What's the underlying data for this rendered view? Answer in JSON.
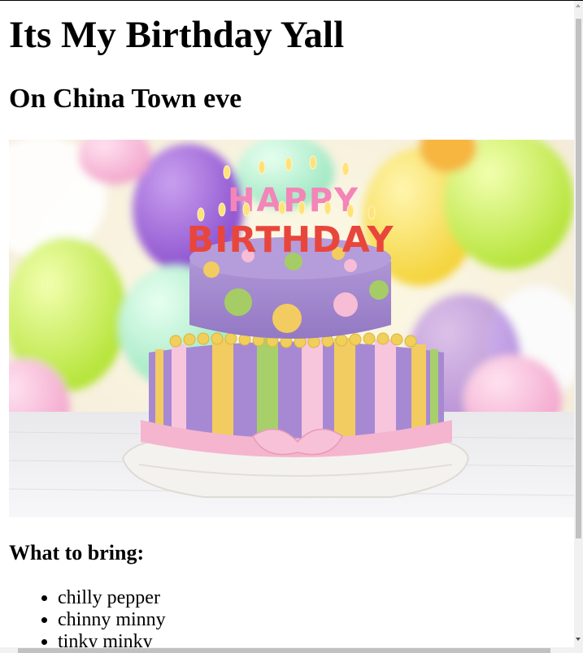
{
  "page": {
    "title": "Its My Birthday Yall",
    "subtitle": "On China Town eve",
    "list_heading": "What to bring:",
    "bring_items": [
      "chilly pepper",
      "chinny minny",
      "tinky minky"
    ]
  },
  "hero_image": {
    "cake_text_line1": "HAPPY",
    "cake_text_line2": "BIRTHDAY"
  },
  "colors": {
    "background": "#ffffff",
    "text": "#000000",
    "scrollbar_track": "#f1f1f1",
    "scrollbar_thumb": "#c1c1c1"
  }
}
